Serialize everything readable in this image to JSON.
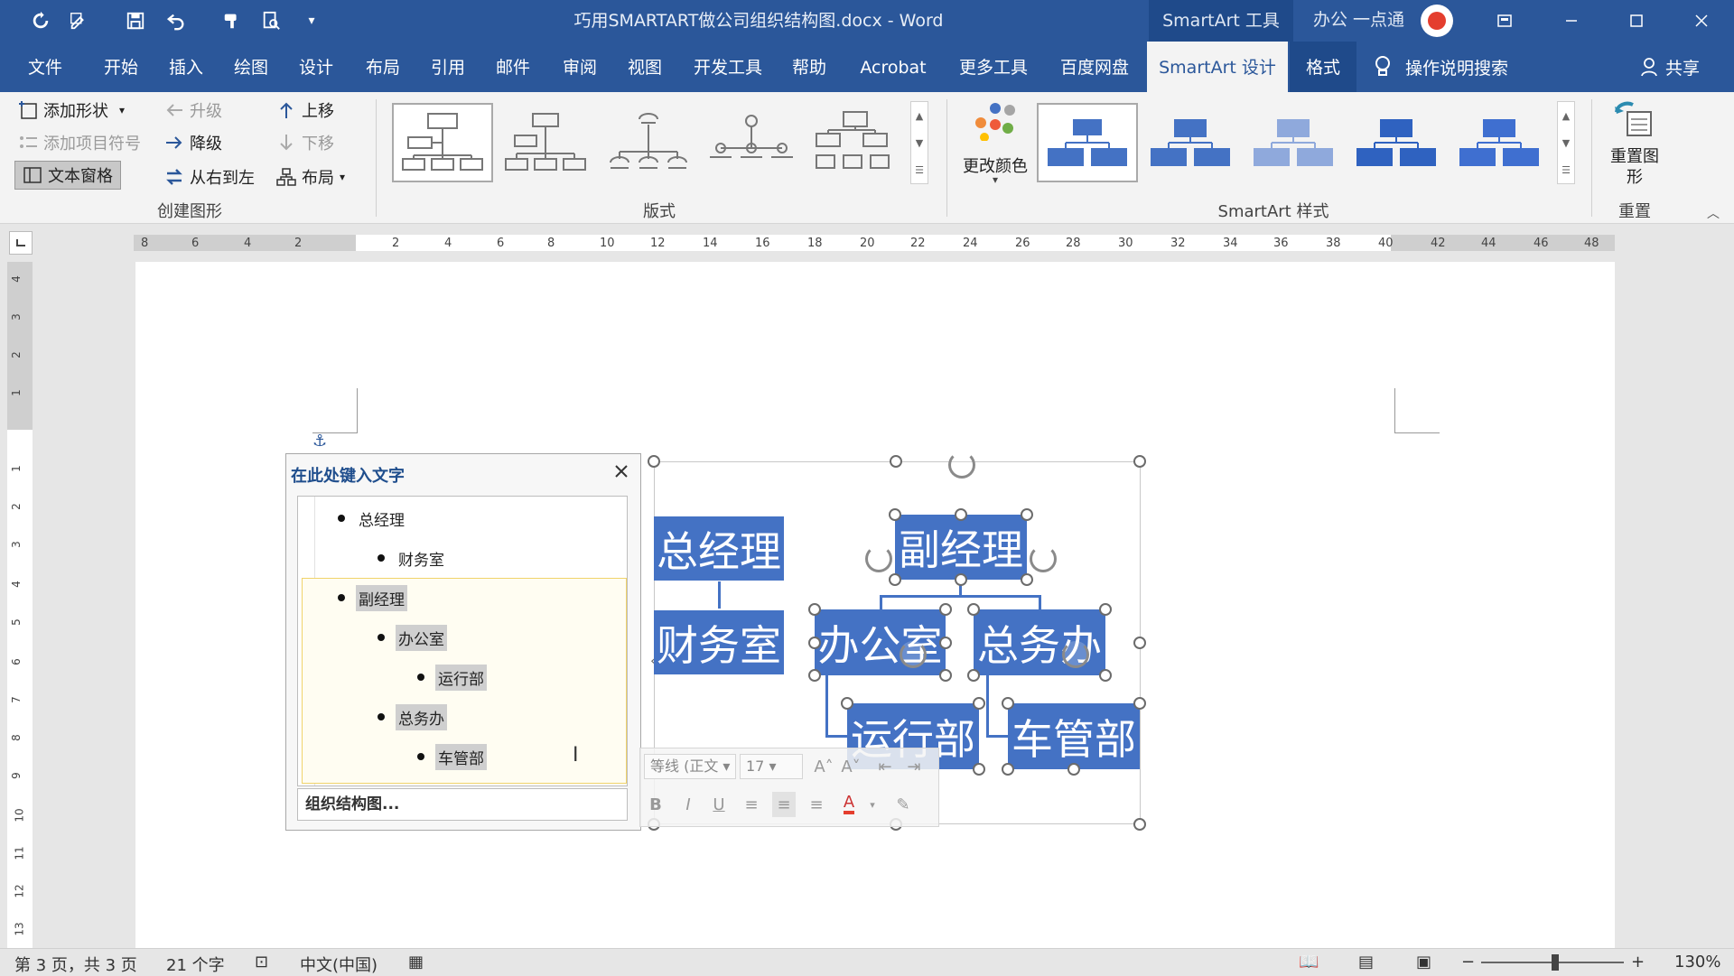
{
  "window": {
    "title": "巧用SMARTART做公司组织结构图.docx  -  Word",
    "smartart_tools": "SmartArt 工具",
    "user": "办公 一点通"
  },
  "tabs": [
    "文件",
    "开始",
    "插入",
    "绘图",
    "设计",
    "布局",
    "引用",
    "邮件",
    "审阅",
    "视图",
    "开发工具",
    "帮助",
    "Acrobat",
    "更多工具",
    "百度网盘",
    "SmartArt 设计",
    "格式"
  ],
  "tell_me": "操作说明搜索",
  "share": "共享",
  "ribbon": {
    "create": {
      "add_shape": "添加形状",
      "add_bullet": "添加项目符号",
      "text_pane": "文本窗格",
      "promote": "升级",
      "demote": "降级",
      "rtl": "从右到左",
      "move_up": "上移",
      "move_down": "下移",
      "layout": "布局",
      "group_label": "创建图形"
    },
    "layouts_label": "版式",
    "change_colors": "更改颜色",
    "styles_label": "SmartArt 样式",
    "reset_graphic": "重置图形",
    "reset_label": "重置"
  },
  "ruler": {
    "h_ticks": [
      "8",
      "6",
      "4",
      "2",
      "2",
      "4",
      "6",
      "8",
      "10",
      "12",
      "14",
      "16",
      "18",
      "20",
      "22",
      "24",
      "26",
      "28",
      "30",
      "32",
      "34",
      "36",
      "38",
      "40",
      "42",
      "44",
      "46",
      "48"
    ],
    "v_ticks": [
      "4",
      "3",
      "2",
      "1",
      "1",
      "2",
      "3",
      "4",
      "5",
      "6",
      "7",
      "8",
      "9",
      "10",
      "11",
      "12",
      "13"
    ]
  },
  "text_pane": {
    "title": "在此处键入文字",
    "items": [
      {
        "text": "总经理",
        "level": 1,
        "hl": false
      },
      {
        "text": "财务室",
        "level": 2,
        "hl": false
      },
      {
        "text": "副经理",
        "level": 1,
        "hl": true
      },
      {
        "text": "办公室",
        "level": 2,
        "hl": true
      },
      {
        "text": "运行部",
        "level": 3,
        "hl": true
      },
      {
        "text": "总务办",
        "level": 2,
        "hl": true
      },
      {
        "text": "车管部",
        "level": 3,
        "hl": true
      }
    ],
    "footer": "组织结构图..."
  },
  "chart": {
    "general_manager": "总经理",
    "finance": "财务室",
    "deputy": "副经理",
    "office": "办公室",
    "general_affairs": "总务办",
    "operations": "运行部",
    "vehicle": "车管部",
    "color": "#4472c4"
  },
  "mini_toolbar": {
    "font": "等线 (正文",
    "size": "17"
  },
  "status": {
    "page": "第 3 页，共 3 页",
    "words": "21 个字",
    "lang": "中文(中国)",
    "zoom": "130%"
  }
}
